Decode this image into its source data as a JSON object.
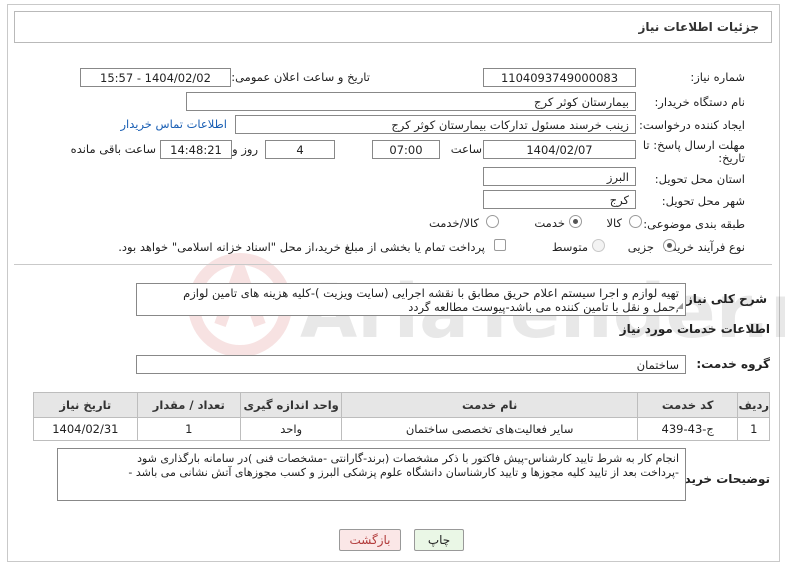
{
  "page": {
    "title": "جزئیات اطلاعات نیاز"
  },
  "form": {
    "need_number_label": "شماره نیاز:",
    "need_number": "1104093749000083",
    "announce_label": "تاریخ و ساعت اعلان عمومی:",
    "announce_value": "1404/02/02 - 15:57",
    "buyer_org_label": "نام دستگاه خریدار:",
    "buyer_org": "بیمارستان کوثر کرج",
    "requester_label": "ایجاد کننده درخواست:",
    "requester": "زینب خرسند مسئول تدارکات بیمارستان کوثر کرج",
    "contact_link": "اطلاعات تماس خریدار",
    "deadline_label_1": "مهلت ارسال پاسخ: تا",
    "deadline_label_2": "تاریخ:",
    "deadline_date": "1404/02/07",
    "time_label": "ساعت",
    "deadline_time": "07:00",
    "days_value": "4",
    "days_label": "روز و",
    "remaining_time": "14:48:21",
    "remaining_label": "ساعت باقی مانده",
    "province_label": "استان محل تحویل:",
    "province": "البرز",
    "city_label": "شهر محل تحویل:",
    "city": "کرج",
    "category_label": "طبقه بندی موضوعی:",
    "category_options": [
      "کالا",
      "خدمت",
      "کالا/خدمت"
    ],
    "category_selected": "خدمت",
    "process_label": "نوع فرآیند خرید :",
    "process_options": [
      "جزیی",
      "متوسط"
    ],
    "process_selected": "جزیی",
    "treasury_note": "پرداخت تمام یا بخشی از مبلغ خرید،از محل \"اسناد خزانه اسلامی\" خواهد بود."
  },
  "description": {
    "label": "شرح کلی نیاز:",
    "text_line1": "تهیه لوازم و اجرا سیستم اعلام حریق مطابق با نقشه اجرایی (سایت ویزیت )-کلیه هزینه های تامین لوازم",
    "text_line2": ",حمل و نقل با  تامین کننده می باشد-پیوست مطالعه گردد"
  },
  "services": {
    "section_title": "اطلاعات خدمات مورد نیاز",
    "group_label": "گروه خدمت:",
    "group_value": "ساختمان",
    "columns": [
      "ردیف",
      "کد خدمت",
      "نام خدمت",
      "واحد اندازه گیری",
      "تعداد / مقدار",
      "تاریخ نیاز"
    ],
    "rows": [
      [
        "1",
        "ج-43-439",
        "سایر فعالیت‌های تخصصی ساختمان",
        "واحد",
        "1",
        "1404/02/31"
      ]
    ]
  },
  "buyer_notes": {
    "label": "توضیحات خریدار:",
    "line1": "انجام کار  به شرط تایید کارشناس-پیش فاکتور با ذکر مشخصات (برند-گارانتی -مشخصات فنی )در سامانه بارگذاری شود",
    "line2": "-پرداخت بعد از  تایید کلیه مجوزها و تایید کارشناسان  دانشگاه علوم پزشکی البرز و کسب مجوزهای آتش نشانی می باشد -"
  },
  "buttons": {
    "print": "چاپ",
    "back": "بازگشت"
  },
  "watermark": "AriaTender.neT",
  "colors": {
    "link": "#1a5fb4",
    "print_bg": "#eaf7e6",
    "back_bg": "#fbe7e7",
    "watermark": "#c62828"
  }
}
